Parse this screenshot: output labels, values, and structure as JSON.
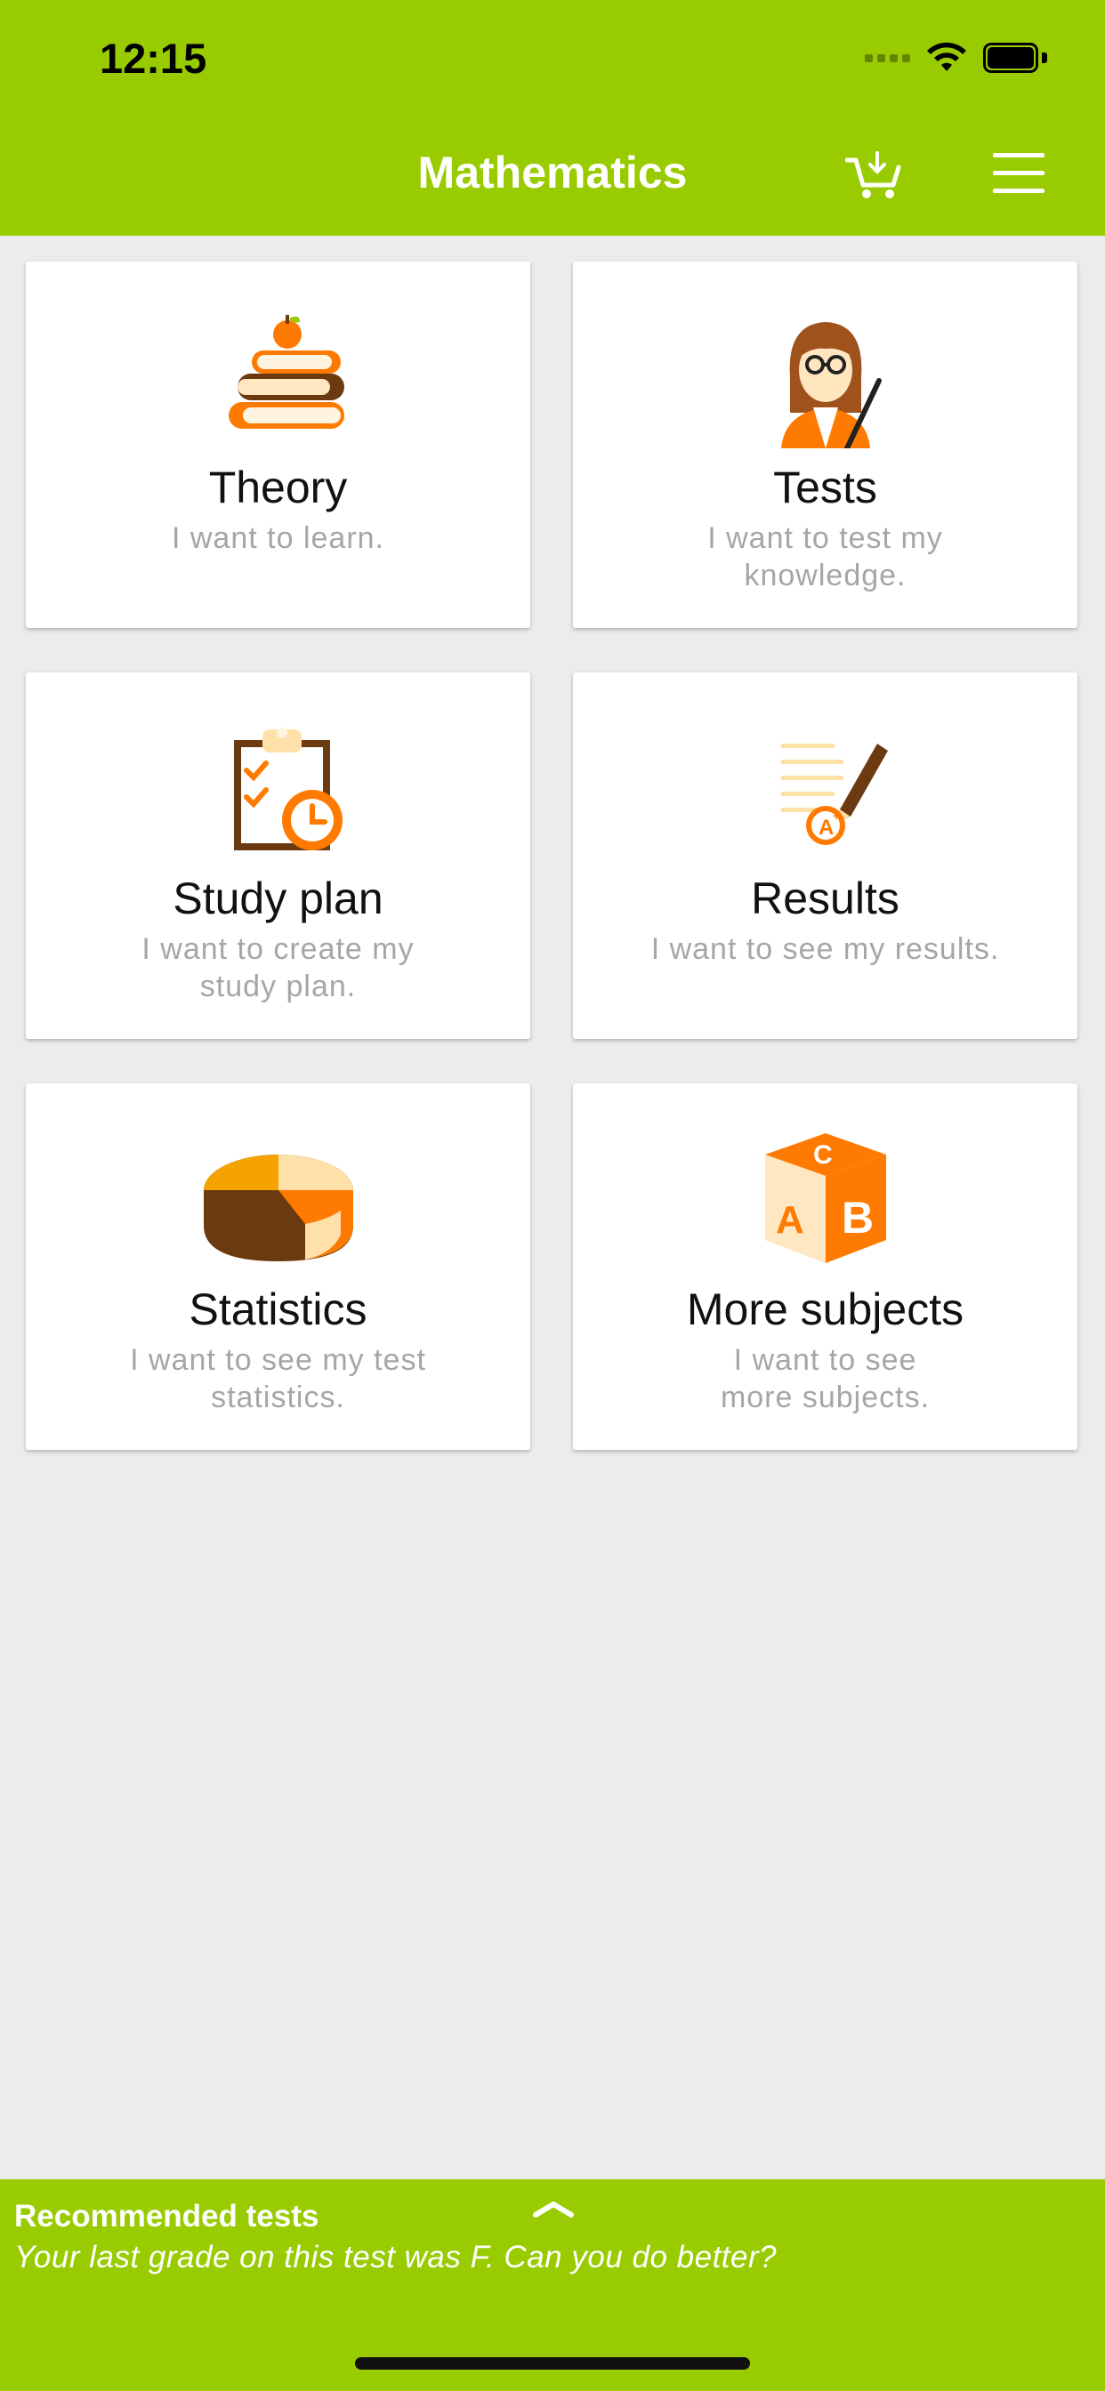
{
  "status_bar": {
    "time": "12:15"
  },
  "header": {
    "title": "Mathematics",
    "cart_icon": "cart-icon",
    "menu_icon": "hamburger-menu-icon"
  },
  "cards": [
    {
      "title": "Theory",
      "subtitle": "I want to learn.",
      "icon": "books-apple-icon"
    },
    {
      "title": "Tests",
      "subtitle": "I want to test my knowledge.",
      "icon": "teacher-icon"
    },
    {
      "title": "Study plan",
      "subtitle": "I want to create my study plan.",
      "icon": "clipboard-clock-icon"
    },
    {
      "title": "Results",
      "subtitle": "I want to see my results.",
      "icon": "grade-pen-icon"
    },
    {
      "title": "Statistics",
      "subtitle": "I want to see my test statistics.",
      "icon": "pie-chart-icon"
    },
    {
      "title": "More subjects",
      "subtitle": "I want to see more subjects.",
      "icon": "abc-block-icon"
    }
  ],
  "recommended": {
    "title": "Recommended tests",
    "message": "Your last grade on this test was F. Can you do better?"
  },
  "colors": {
    "accent": "#99cc00",
    "background": "#ececec",
    "orange": "#ff7a00",
    "brown": "#6b3a10"
  }
}
